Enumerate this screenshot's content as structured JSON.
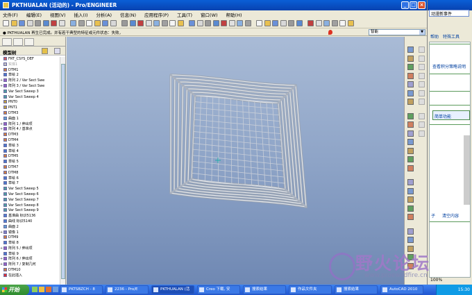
{
  "window": {
    "title": "PKTHUALAN (活动的) - Pro/ENGINEER",
    "controls": [
      "_",
      "□",
      "×"
    ]
  },
  "menu": [
    "文件(F)",
    "编辑(E)",
    "视图(V)",
    "插入(I)",
    "分析(A)",
    "信息(N)",
    "应用程序(P)",
    "工具(T)",
    "窗口(W)",
    "帮助(H)"
  ],
  "message": {
    "text": "● PKTHUALAN 再生已完成。并有若干典型的特征或元件状态：失败，",
    "selector": "智能"
  },
  "model_tree": {
    "header": "模型树",
    "items": [
      {
        "text": "FRT_CSYS_DEF",
        "kind": "csys",
        "dim": false,
        "plus": false
      },
      {
        "text": "实体1",
        "kind": "solid",
        "dim": true,
        "plus": false
      },
      {
        "text": "DTM1",
        "kind": "datum",
        "dim": false,
        "plus": false
      },
      {
        "text": "草绘 2",
        "kind": "sketch",
        "dim": false,
        "plus": false
      },
      {
        "text": "阵列 2 / Var Sect Swe",
        "kind": "pattern",
        "dim": false,
        "plus": true
      },
      {
        "text": "阵列 3 / Var Sect Swe",
        "kind": "pattern",
        "dim": false,
        "plus": true
      },
      {
        "text": "Var Sect Sweep 3",
        "kind": "sweep",
        "dim": false,
        "plus": false
      },
      {
        "text": "Var Sect Sweep 4",
        "kind": "sweep",
        "dim": false,
        "plus": false
      },
      {
        "text": "PNT0",
        "kind": "point",
        "dim": false,
        "plus": false
      },
      {
        "text": "PNT1",
        "kind": "point",
        "dim": false,
        "plus": false
      },
      {
        "text": "DTM3",
        "kind": "datum",
        "dim": false,
        "plus": false
      },
      {
        "text": "曲面 1",
        "kind": "surface",
        "dim": false,
        "plus": false
      },
      {
        "text": "阵列 1 / 伸出项",
        "kind": "pattern",
        "dim": false,
        "plus": true
      },
      {
        "text": "阵列 4 / 基准点",
        "kind": "pattern",
        "dim": false,
        "plus": true
      },
      {
        "text": "DTM3",
        "kind": "datum",
        "dim": false,
        "plus": false
      },
      {
        "text": "DTM4",
        "kind": "datum",
        "dim": false,
        "plus": false
      },
      {
        "text": "草绘 3",
        "kind": "sketch",
        "dim": false,
        "plus": false
      },
      {
        "text": "草绘 4",
        "kind": "sketch",
        "dim": false,
        "plus": false
      },
      {
        "text": "DTM5",
        "kind": "datum",
        "dim": false,
        "plus": false
      },
      {
        "text": "草绘 5",
        "kind": "sketch",
        "dim": false,
        "plus": false
      },
      {
        "text": "DTM7",
        "kind": "datum",
        "dim": false,
        "plus": false
      },
      {
        "text": "DTM8",
        "kind": "datum",
        "dim": false,
        "plus": false
      },
      {
        "text": "草绘 6",
        "kind": "sketch",
        "dim": false,
        "plus": false
      },
      {
        "text": "草绘 7",
        "kind": "sketch",
        "dim": false,
        "plus": false
      },
      {
        "text": "Var Sect Sweep 5",
        "kind": "sweep",
        "dim": false,
        "plus": false
      },
      {
        "text": "Var Sect Sweep 6",
        "kind": "sweep",
        "dim": false,
        "plus": false
      },
      {
        "text": "Var Sect Sweep 7",
        "kind": "sweep",
        "dim": false,
        "plus": false
      },
      {
        "text": "Var Sect Sweep 8",
        "kind": "sweep",
        "dim": false,
        "plus": false
      },
      {
        "text": "Var Sect Sweep 9",
        "kind": "sweep",
        "dim": false,
        "plus": false
      },
      {
        "text": "基准曲 标识5136",
        "kind": "curve",
        "dim": false,
        "plus": false
      },
      {
        "text": "曲线 标识5140",
        "kind": "curve",
        "dim": false,
        "plus": false
      },
      {
        "text": "曲面 2",
        "kind": "surface",
        "dim": false,
        "plus": false
      },
      {
        "text": "镜像 1",
        "kind": "mirror",
        "dim": false,
        "plus": true
      },
      {
        "text": "DTM9",
        "kind": "datum",
        "dim": false,
        "plus": false
      },
      {
        "text": "草绘 8",
        "kind": "sketch",
        "dim": false,
        "plus": false
      },
      {
        "text": "阵列 5 / 伸出项",
        "kind": "pattern",
        "dim": false,
        "plus": true
      },
      {
        "text": "草绘 9",
        "kind": "sketch",
        "dim": false,
        "plus": false
      },
      {
        "text": "阵列 6 / 伸出项",
        "kind": "pattern",
        "dim": false,
        "plus": true
      },
      {
        "text": "阵列 7 / 复制几何",
        "kind": "pattern",
        "dim": false,
        "plus": true
      },
      {
        "text": "DTM10",
        "kind": "datum",
        "dim": false,
        "plus": false
      },
      {
        "text": "在此插入",
        "kind": "insert",
        "dim": false,
        "plus": false
      }
    ]
  },
  "right_window": {
    "tab": "动漫新事件",
    "btn1": "帮助",
    "btn2": "特殊工具",
    "link": "查看积分策略说明",
    "block1": "简单功能",
    "label1": "子",
    "label2": "清空内容"
  },
  "watermark": {
    "text": "野火论坛",
    "url": "www.proewildfire.cn",
    "zoom": "100%"
  },
  "taskbar": {
    "start": "开始",
    "tasks": [
      "PKTSBZCH - 8",
      "2236 - Pro/E",
      "PKTHUALAN (活",
      "Creo 下载, 安",
      "搜索结果",
      "作品文件夹",
      "搜索结果",
      "AutoCAD 2010"
    ],
    "clock": "15:30"
  },
  "colors": {
    "titlebar": "#0a5fd6",
    "viewport_top": "#a9bbd6",
    "viewport_bottom": "#6f88b3",
    "taskbar": "#2a62dc",
    "start": "#3c9a3a"
  }
}
